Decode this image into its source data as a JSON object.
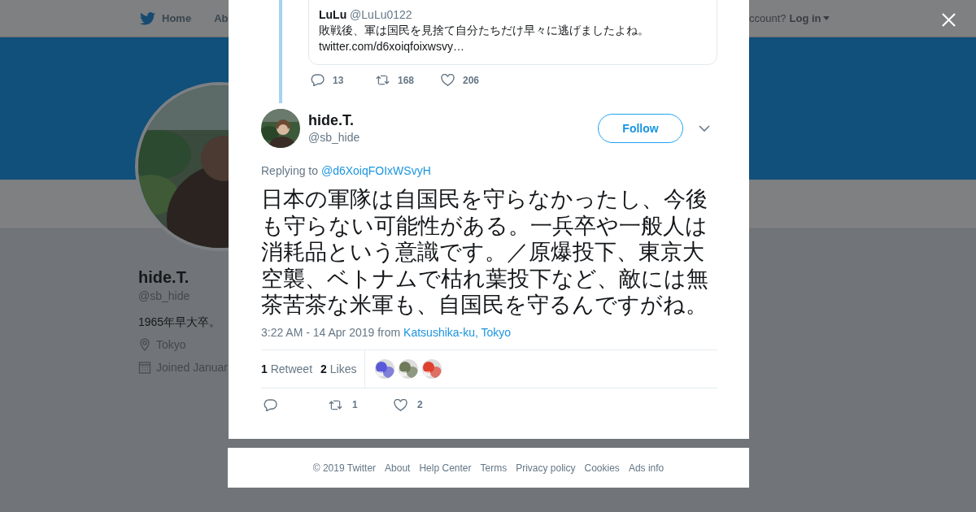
{
  "background_page": {
    "nav": {
      "home": "Home",
      "about": "Ab",
      "account_prompt": "ccount?",
      "login": "Log in"
    },
    "profile": {
      "name": "hide.T.",
      "handle": "@sb_hide",
      "bio": "1965年早大卒。",
      "location": "Tokyo",
      "joined": "Joined Januar"
    }
  },
  "thread": {
    "quoted_tweet": {
      "name": "LuLu",
      "handle": "@LuLu0122",
      "text": "敗戦後、軍は国民を見捨て自分たちだけ早々に逃げましたよね。",
      "link": "twitter.com/d6xoiqfoixwsvy…"
    },
    "actions": {
      "replies": "13",
      "retweets": "168",
      "likes": "206"
    }
  },
  "tweet": {
    "name": "hide.T.",
    "handle": "@sb_hide",
    "follow": "Follow",
    "replying_label": "Replying to",
    "replying_to": "@d6XoiqFOIxWSvyH",
    "text": "日本の軍隊は自国民を守らなかったし、今後も守らない可能性がある。一兵卒や一般人は消耗品という意識です。／原爆投下、東京大空襲、ベトナムで枯れ葉投下など、敵には無茶苦茶な米軍も、自国民を守るんですがね。",
    "time": "3:22 AM - 14 Apr 2019",
    "from": "from",
    "place": "Katsushika-ku, Tokyo",
    "stats": [
      {
        "count": "1",
        "label": "Retweet"
      },
      {
        "count": "2",
        "label": "Likes"
      }
    ],
    "actions": {
      "retweets": "1",
      "likes": "2"
    }
  },
  "footer": [
    "© 2019 Twitter",
    "About",
    "Help Center",
    "Terms",
    "Privacy policy",
    "Cookies",
    "Ads info"
  ]
}
